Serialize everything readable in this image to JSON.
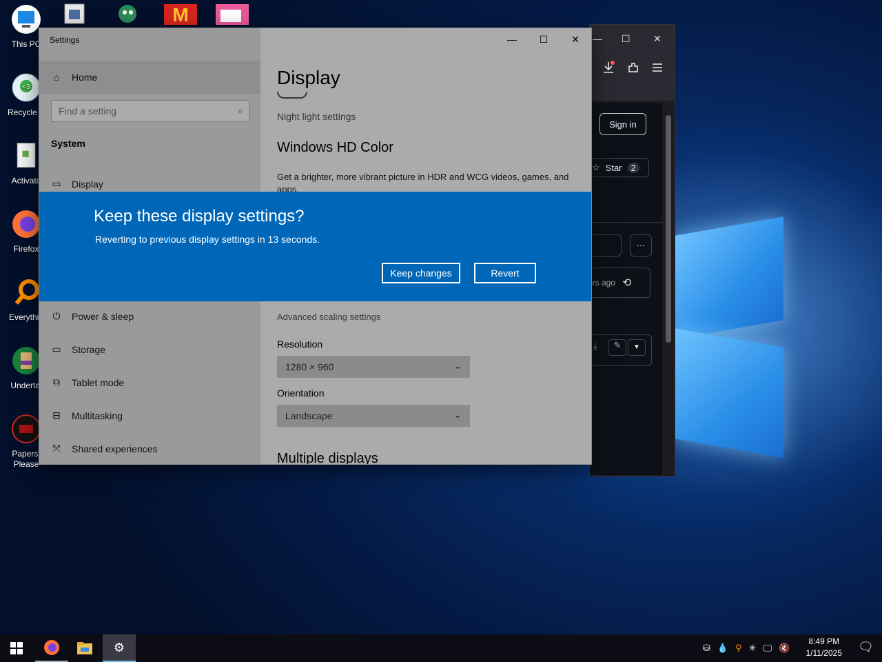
{
  "desktop": {
    "icons": [
      {
        "label": "This PC"
      },
      {
        "label": "Recycle B"
      },
      {
        "label": "Activato"
      },
      {
        "label": "Firefox"
      },
      {
        "label": "Everythin"
      },
      {
        "label": "Undertal"
      },
      {
        "label": "Papers, Please"
      }
    ]
  },
  "browser": {
    "sign_in": "Sign in",
    "star_label": "Star",
    "star_count": "2",
    "more": "⋯",
    "time_ago": "ars ago"
  },
  "settings": {
    "window_title": "Settings",
    "minimize": "—",
    "maximize": "☐",
    "close": "✕",
    "nav": {
      "home": "Home",
      "search_placeholder": "Find a setting",
      "section": "System",
      "items": [
        "Display",
        "Power & sleep",
        "Storage",
        "Tablet mode",
        "Multitasking",
        "Shared experiences"
      ]
    },
    "page_title": "Display",
    "night_light_link": "Night light settings",
    "hd_color_heading": "Windows HD Color",
    "hd_color_desc": "Get a brighter, more vibrant picture in HDR and WCG videos, games, and apps.",
    "advanced_scaling_link": "Advanced scaling settings",
    "resolution_label": "Resolution",
    "resolution_value": "1280 × 960",
    "orientation_label": "Orientation",
    "orientation_value": "Landscape",
    "multiple_displays_heading": "Multiple displays"
  },
  "dialog": {
    "title": "Keep these display settings?",
    "message": "Reverting to previous display settings in 13 seconds.",
    "keep_label": "Keep changes",
    "revert_label": "Revert"
  },
  "taskbar": {
    "time": "8:49 PM",
    "date": "1/11/2025"
  },
  "colors": {
    "dialog_blue": "#0067b8",
    "desktop_blue": "#06275e",
    "taskbar": "#0c0c14"
  }
}
